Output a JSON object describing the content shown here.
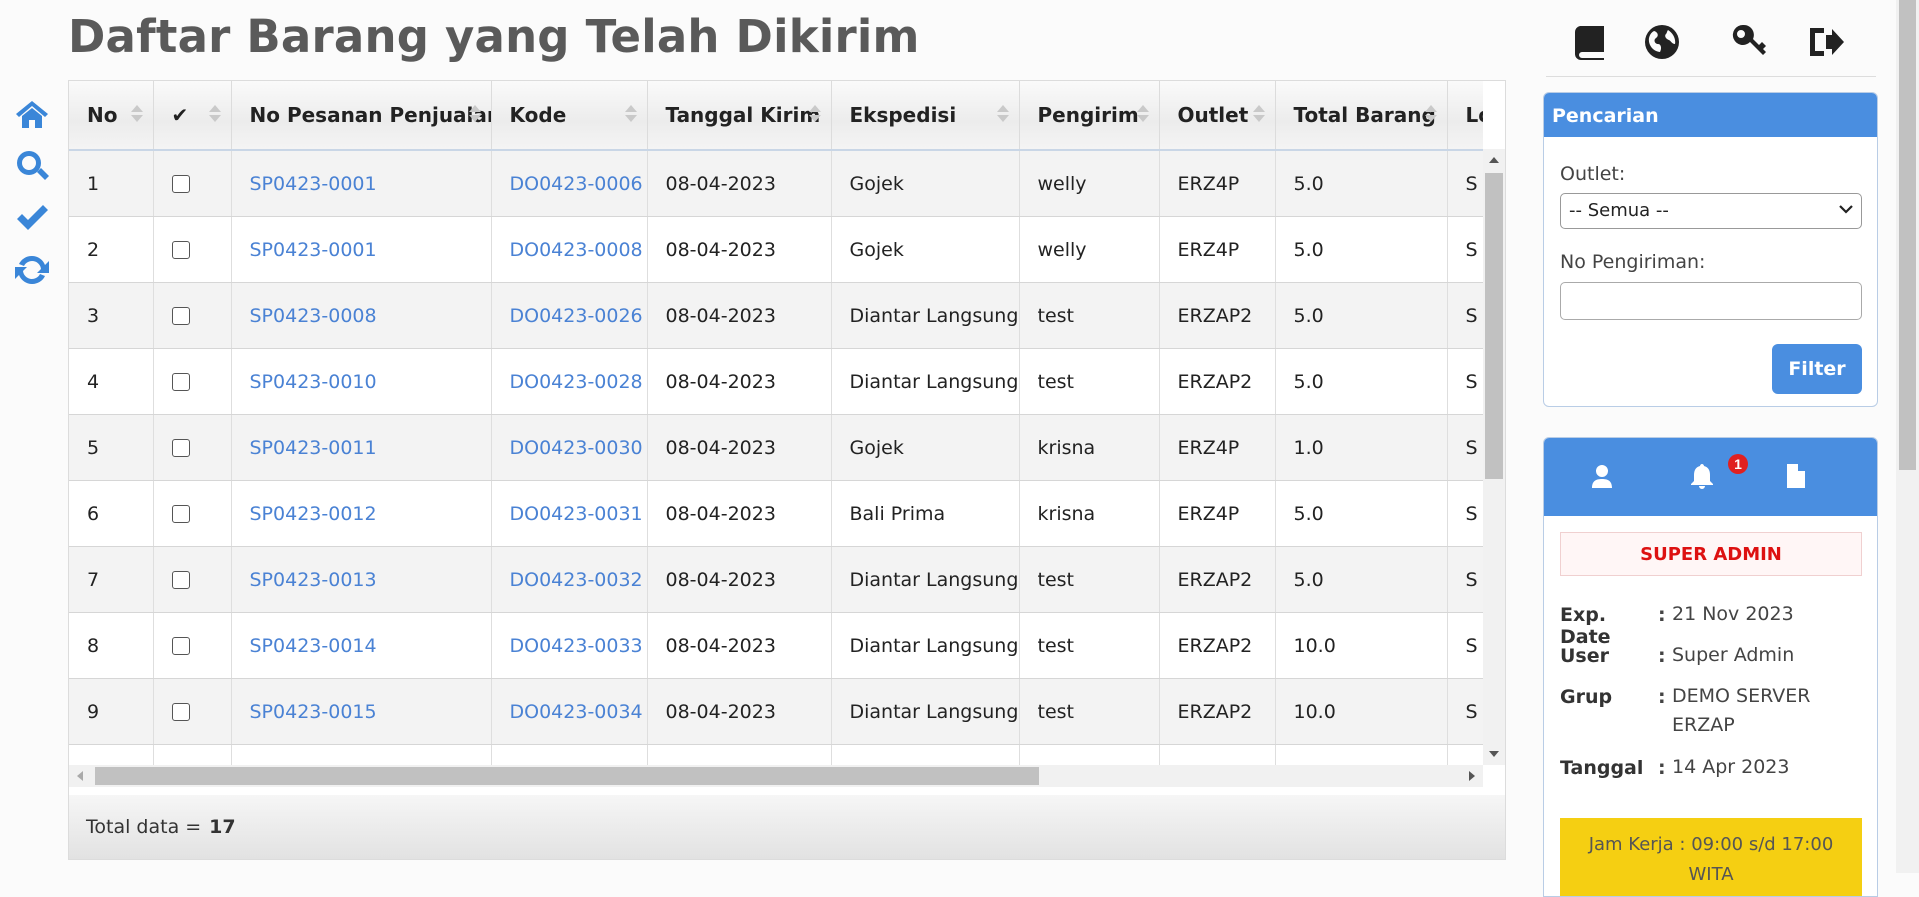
{
  "page_title": "Daftar Barang yang Telah Dikirim",
  "side_nav": [
    "home-icon",
    "search-icon",
    "check-icon",
    "refresh-icon"
  ],
  "top_icons": [
    "book-icon",
    "globe-icon",
    "key-icon",
    "logout-icon"
  ],
  "table": {
    "columns": [
      "No",
      "✔",
      "No Pesanan Penjualan",
      "Kode",
      "Tanggal Kirim",
      "Ekspedisi",
      "Pengirim",
      "Outlet",
      "Total Barang",
      "Log"
    ],
    "rows": [
      {
        "no": "1",
        "pesanan": "SP0423-0001",
        "kode": "DO0423-0006",
        "tanggal": "08-04-2023",
        "ekspedisi": "Gojek",
        "pengirim": "welly",
        "outlet": "ERZ4P",
        "total": "5.0",
        "log": "S"
      },
      {
        "no": "2",
        "pesanan": "SP0423-0001",
        "kode": "DO0423-0008",
        "tanggal": "08-04-2023",
        "ekspedisi": "Gojek",
        "pengirim": "welly",
        "outlet": "ERZ4P",
        "total": "5.0",
        "log": "S"
      },
      {
        "no": "3",
        "pesanan": "SP0423-0008",
        "kode": "DO0423-0026",
        "tanggal": "08-04-2023",
        "ekspedisi": "Diantar Langsung",
        "pengirim": "test",
        "outlet": "ERZAP2",
        "total": "5.0",
        "log": "S"
      },
      {
        "no": "4",
        "pesanan": "SP0423-0010",
        "kode": "DO0423-0028",
        "tanggal": "08-04-2023",
        "ekspedisi": "Diantar Langsung",
        "pengirim": "test",
        "outlet": "ERZAP2",
        "total": "5.0",
        "log": "S"
      },
      {
        "no": "5",
        "pesanan": "SP0423-0011",
        "kode": "DO0423-0030",
        "tanggal": "08-04-2023",
        "ekspedisi": "Gojek",
        "pengirim": "krisna",
        "outlet": "ERZ4P",
        "total": "1.0",
        "log": "S"
      },
      {
        "no": "6",
        "pesanan": "SP0423-0012",
        "kode": "DO0423-0031",
        "tanggal": "08-04-2023",
        "ekspedisi": "Bali Prima",
        "pengirim": "krisna",
        "outlet": "ERZ4P",
        "total": "5.0",
        "log": "S"
      },
      {
        "no": "7",
        "pesanan": "SP0423-0013",
        "kode": "DO0423-0032",
        "tanggal": "08-04-2023",
        "ekspedisi": "Diantar Langsung",
        "pengirim": "test",
        "outlet": "ERZAP2",
        "total": "5.0",
        "log": "S"
      },
      {
        "no": "8",
        "pesanan": "SP0423-0014",
        "kode": "DO0423-0033",
        "tanggal": "08-04-2023",
        "ekspedisi": "Diantar Langsung",
        "pengirim": "test",
        "outlet": "ERZAP2",
        "total": "10.0",
        "log": "S"
      },
      {
        "no": "9",
        "pesanan": "SP0423-0015",
        "kode": "DO0423-0034",
        "tanggal": "08-04-2023",
        "ekspedisi": "Diantar Langsung",
        "pengirim": "test",
        "outlet": "ERZAP2",
        "total": "10.0",
        "log": "S"
      },
      {
        "no": "",
        "pesanan": "",
        "kode": "",
        "tanggal": "",
        "ekspedisi": "",
        "pengirim": "",
        "outlet": "",
        "total": "",
        "log": ""
      }
    ],
    "footer_label": "Total data =",
    "footer_count": "17"
  },
  "search_panel": {
    "title": "Pencarian",
    "outlet_label": "Outlet:",
    "outlet_value": "-- Semua --",
    "pengiriman_label": "No Pengiriman:",
    "pengiriman_value": "",
    "filter_button": "Filter"
  },
  "user_panel": {
    "notification_count": "1",
    "role": "SUPER ADMIN",
    "info": [
      {
        "key": "Exp. Date",
        "value": "21 Nov 2023"
      },
      {
        "key": "User",
        "value": "Super Admin"
      },
      {
        "key": "Grup",
        "value": "DEMO SERVER ERZAP"
      },
      {
        "key": "Tanggal",
        "value": "14 Apr 2023"
      }
    ],
    "jam_kerja": "Jam Kerja : 09:00 s/d 17:00 WITA"
  },
  "colors": {
    "accent": "#4a8ee0",
    "link": "#4a82d4",
    "role": "#dd1111",
    "jam_bg": "#f5cf12",
    "badge": "#e02020"
  }
}
